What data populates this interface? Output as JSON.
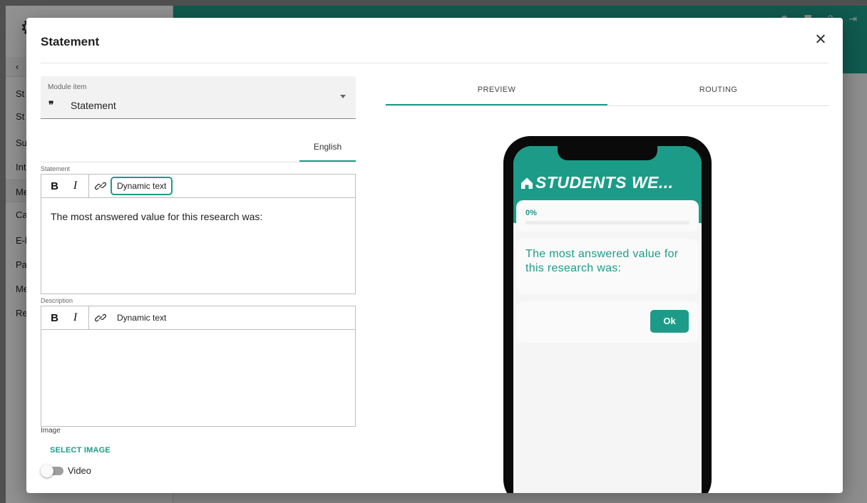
{
  "background": {
    "sidebar_items": [
      "St",
      "St",
      "Su",
      "Int",
      "Me",
      "Ca",
      "E-l",
      "Pa",
      "Me",
      "Re"
    ],
    "top_icons": [
      "gear-icon",
      "shield-icon",
      "help-icon",
      "logout-icon"
    ]
  },
  "modal": {
    "title": "Statement",
    "module_item": {
      "label": "Module item",
      "quote_glyph": "❞",
      "value": "Statement"
    },
    "language_tab": "English",
    "statement": {
      "label": "Statement",
      "bold": "B",
      "italic": "I",
      "dynamic_text": "Dynamic text",
      "content": "The most answered value for this research was:"
    },
    "description": {
      "label": "Description",
      "bold": "B",
      "italic": "I",
      "dynamic_text": "Dynamic text",
      "content": ""
    },
    "image_label": "Image",
    "select_image": "SELECT IMAGE",
    "video_label": "Video",
    "video_enabled": false
  },
  "tabs": [
    {
      "label": "PREVIEW",
      "active": true
    },
    {
      "label": "ROUTING",
      "active": false
    }
  ],
  "preview": {
    "app_title": "STUDENTS WE...",
    "progress_text": "0%",
    "progress_value": 0,
    "question": "The most answered value for this research was:",
    "ok_label": "Ok"
  },
  "colors": {
    "accent": "#1c9c88"
  }
}
